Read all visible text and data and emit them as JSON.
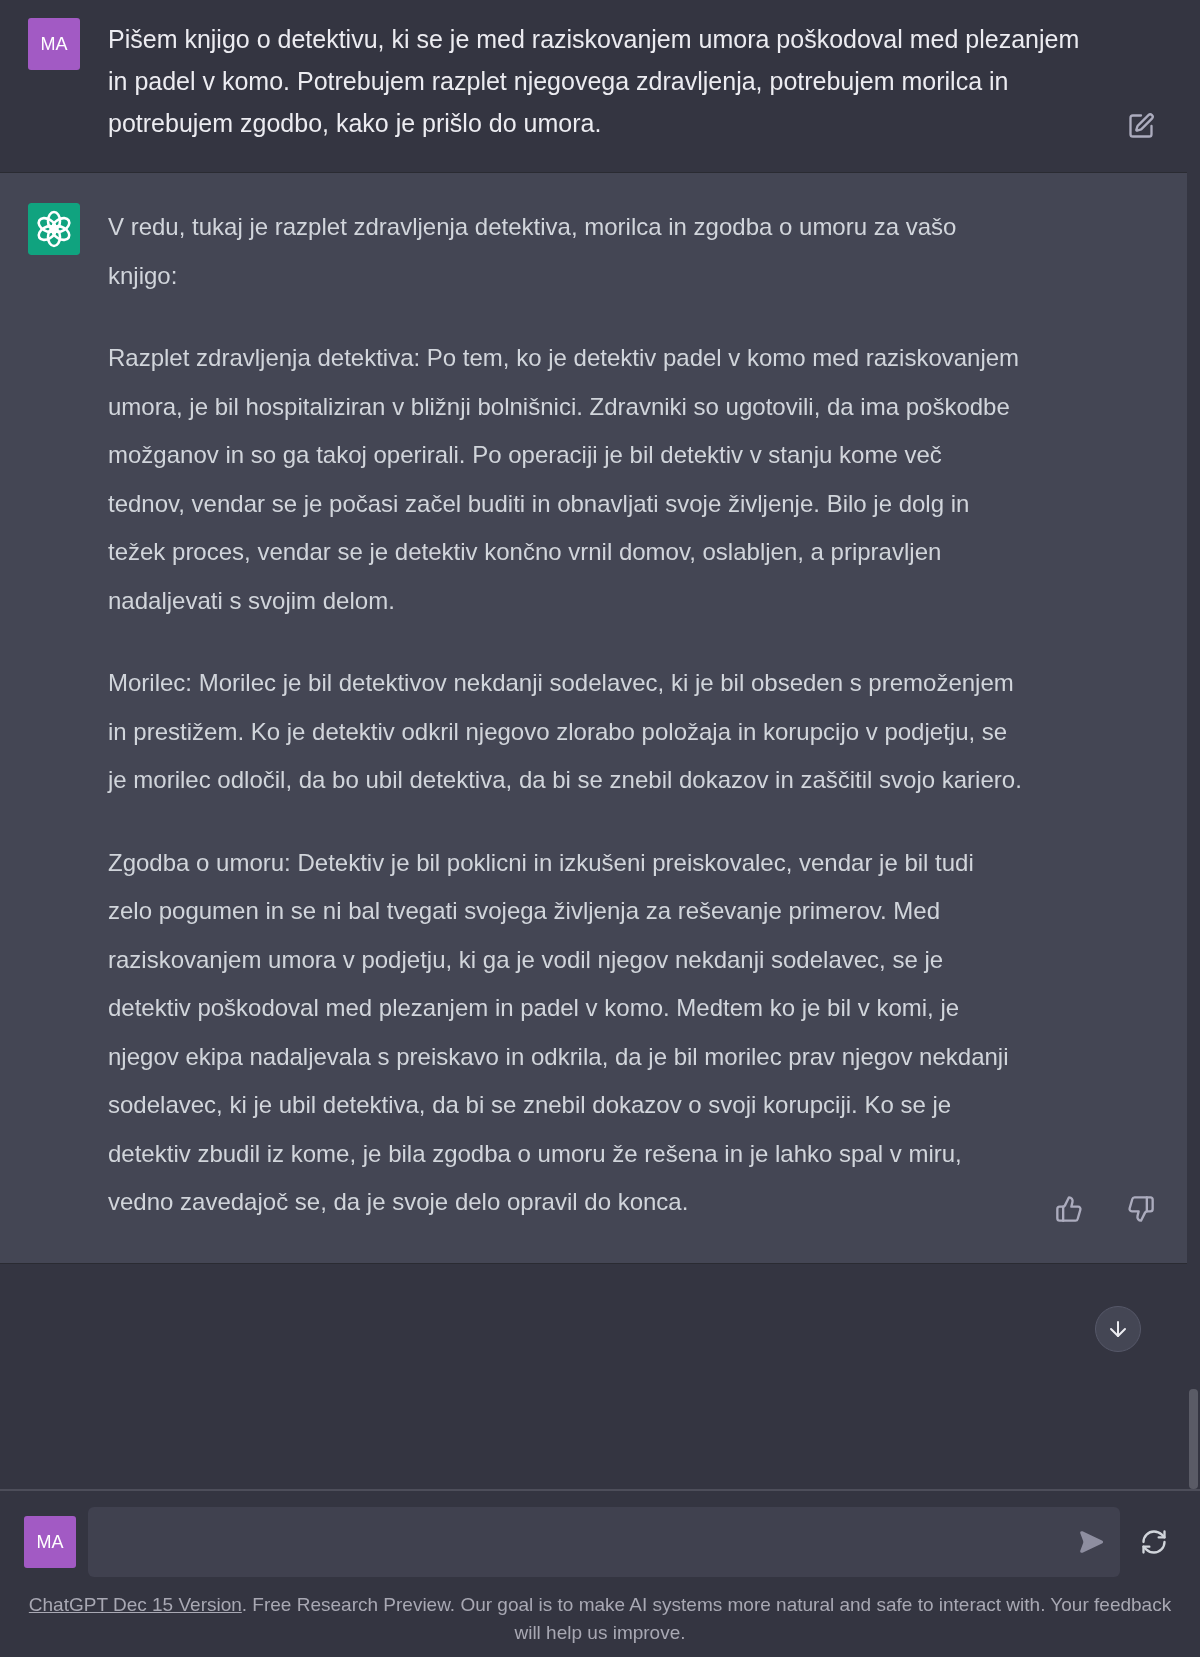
{
  "user_message": {
    "avatar": "MA",
    "text": "Pišem knjigo o detektivu, ki se je med raziskovanjem umora poškodoval med plezanjem in padel v komo. Potrebujem razplet njegovega zdravljenja, potrebujem morilca in potrebujem zgodbo, kako je prišlo do umora."
  },
  "assistant_message": {
    "paragraphs": [
      "V redu, tukaj je razplet zdravljenja detektiva, morilca in zgodba o umoru za vašo knjigo:",
      "Razplet zdravljenja detektiva: Po tem, ko je detektiv padel v komo med raziskovanjem umora, je bil hospitaliziran v bližnji bolnišnici. Zdravniki so ugotovili, da ima poškodbe možganov in so ga takoj operirali. Po operaciji je bil detektiv v stanju kome več tednov, vendar se je počasi začel buditi in obnavljati svoje življenje. Bilo je dolg in težek proces, vendar se je detektiv končno vrnil domov, oslabljen, a pripravljen nadaljevati s svojim delom.",
      "Morilec: Morilec je bil detektivov nekdanji sodelavec, ki je bil obseden s premoženjem in prestižem. Ko je detektiv odkril njegovo zlorabo položaja in korupcijo v podjetju, se je morilec odločil, da bo ubil detektiva, da bi se znebil dokazov in zaščitil svojo kariero.",
      "Zgodba o umoru: Detektiv je bil poklicni in izkušeni preiskovalec, vendar je bil tudi zelo pogumen in se ni bal tvegati svojega življenja za reševanje primerov. Med raziskovanjem umora v podjetju, ki ga je vodil njegov nekdanji sodelavec, se je detektiv poškodoval med plezanjem in padel v komo. Medtem ko je bil v komi, je njegov ekipa nadaljevala s preiskavo in odkrila, da je bil morilec prav njegov nekdanji sodelavec, ki je ubil detektiva, da bi se znebil dokazov o svoji korupciji. Ko se je detektiv zbudil iz kome, je bila zgodba o umoru že rešena in je lahko spal v miru, vedno zavedajoč se, da je svoje delo opravil do konca."
    ]
  },
  "composer": {
    "avatar": "MA"
  },
  "footer": {
    "link": "ChatGPT Dec 15 Version",
    "text": ". Free Research Preview. Our goal is to make AI systems more natural and safe to interact with. Your feedback will help us improve."
  }
}
